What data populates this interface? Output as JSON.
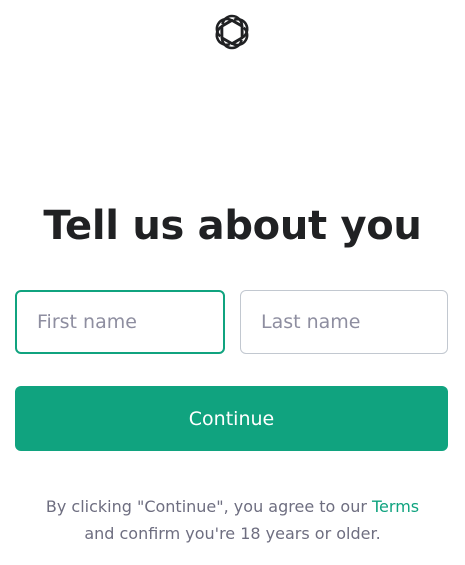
{
  "brand": {
    "logo_icon": "openai-logo-icon",
    "accent_color": "#10a37f"
  },
  "page": {
    "title": "Tell us about you"
  },
  "form": {
    "first_name_placeholder": "First name",
    "first_name_value": "",
    "last_name_placeholder": "Last name",
    "last_name_value": "",
    "continue_label": "Continue"
  },
  "legal": {
    "line1_prefix": "By clicking \"Continue\", you agree to our ",
    "terms_link": "Terms",
    "line2": "and confirm you're 18 years or older."
  }
}
